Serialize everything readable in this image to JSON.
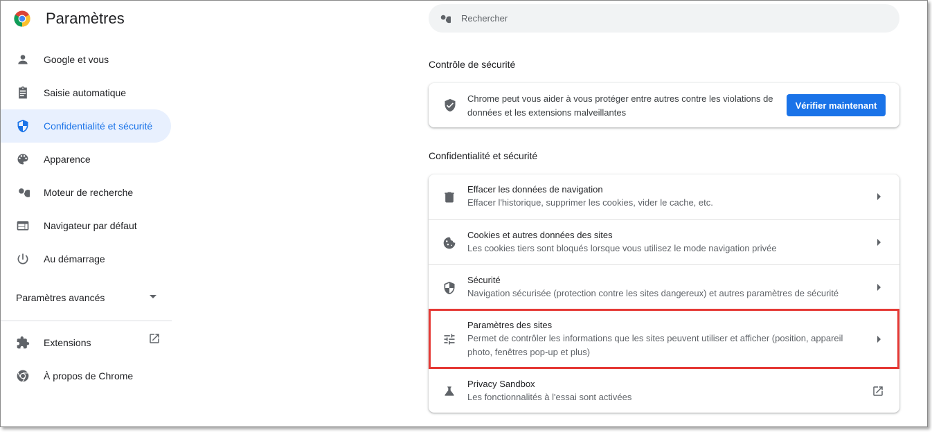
{
  "app": {
    "title": "Paramètres"
  },
  "sidebar": {
    "items": [
      {
        "label": "Google et vous",
        "icon": "person-icon"
      },
      {
        "label": "Saisie automatique",
        "icon": "clipboard-icon"
      },
      {
        "label": "Confidentialité et sécurité",
        "icon": "shield-icon",
        "active": true
      },
      {
        "label": "Apparence",
        "icon": "palette-icon"
      },
      {
        "label": "Moteur de recherche",
        "icon": "search-icon"
      },
      {
        "label": "Navigateur par défaut",
        "icon": "browser-icon"
      },
      {
        "label": "Au démarrage",
        "icon": "power-icon"
      }
    ],
    "advanced_label": "Paramètres avancés",
    "extensions_label": "Extensions",
    "about_label": "À propos de Chrome"
  },
  "search": {
    "placeholder": "Rechercher"
  },
  "safety_check": {
    "section_title": "Contrôle de sécurité",
    "text": "Chrome peut vous aider à vous protéger entre autres contre les violations de données et les extensions malveillantes",
    "button_label": "Vérifier maintenant"
  },
  "privacy": {
    "section_title": "Confidentialité et sécurité",
    "rows": [
      {
        "title": "Effacer les données de navigation",
        "subtitle": "Effacer l'historique, supprimer les cookies, vider le cache, etc."
      },
      {
        "title": "Cookies et autres données des sites",
        "subtitle": "Les cookies tiers sont bloqués lorsque vous utilisez le mode navigation privée"
      },
      {
        "title": "Sécurité",
        "subtitle": "Navigation sécurisée (protection contre les sites dangereux) et autres paramètres de sécurité"
      },
      {
        "title": "Paramètres des sites",
        "subtitle": "Permet de contrôler les informations que les sites peuvent utiliser et afficher (position, appareil photo, fenêtres pop-up et plus)"
      },
      {
        "title": "Privacy Sandbox",
        "subtitle": "Les fonctionnalités à l'essai sont activées"
      }
    ]
  },
  "colors": {
    "accent": "#1a73e8",
    "active_bg": "#e8f0fe",
    "highlight": "#e53935"
  }
}
